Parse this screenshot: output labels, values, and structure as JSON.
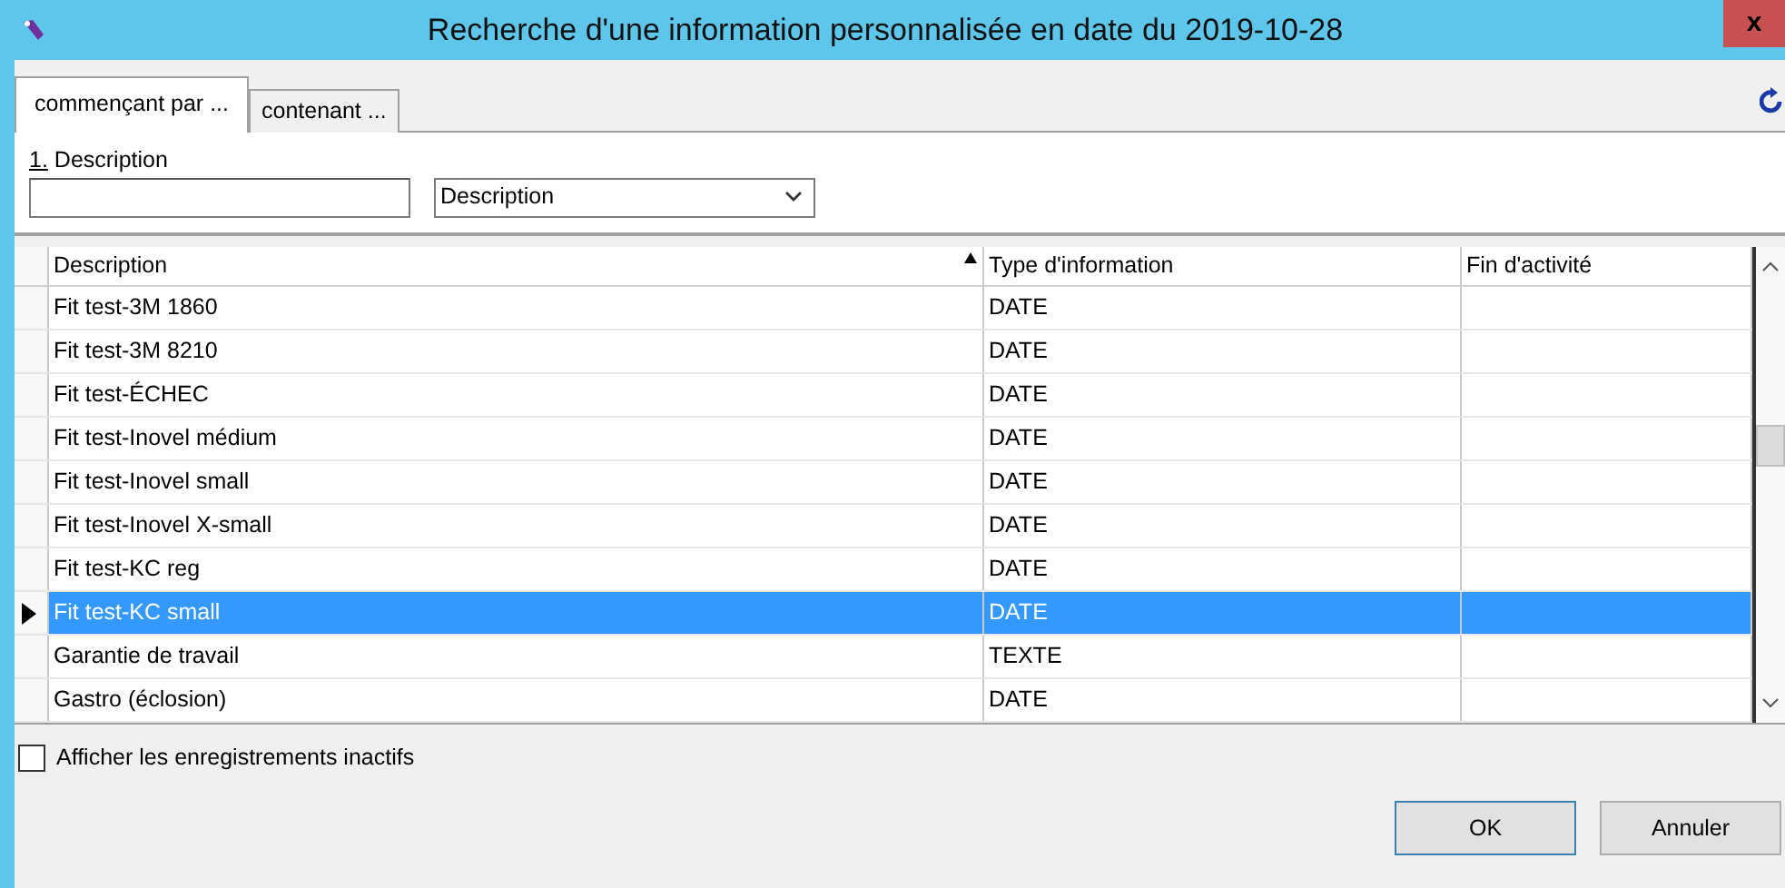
{
  "window": {
    "title": "Recherche d'une information personnalisée en date du 2019-10-28",
    "close": "x"
  },
  "tabs": [
    {
      "label": "commençant par ...",
      "selected": true
    },
    {
      "label": "contenant ...",
      "selected": false
    }
  ],
  "search": {
    "label": "1. Description",
    "field": "Description"
  },
  "table": {
    "columns": [
      {
        "label": "Description",
        "sorted": true
      },
      {
        "label": "Type d'information",
        "sorted": false
      },
      {
        "label": "Fin d'activité",
        "sorted": false
      }
    ],
    "rows": [
      {
        "cells": [
          "Fit test-3M 1860",
          "DATE",
          ""
        ],
        "selected": false
      },
      {
        "cells": [
          "Fit test-3M 8210",
          "DATE",
          ""
        ],
        "selected": false
      },
      {
        "cells": [
          "Fit test-ÉCHEC",
          "DATE",
          ""
        ],
        "selected": false
      },
      {
        "cells": [
          "Fit test-Inovel médium",
          "DATE",
          ""
        ],
        "selected": false
      },
      {
        "cells": [
          "Fit test-Inovel small",
          "DATE",
          ""
        ],
        "selected": false
      },
      {
        "cells": [
          "Fit test-Inovel X-small",
          "DATE",
          ""
        ],
        "selected": false
      },
      {
        "cells": [
          "Fit test-KC reg",
          "DATE",
          ""
        ],
        "selected": false
      },
      {
        "cells": [
          "Fit test-KC small",
          "DATE",
          ""
        ],
        "selected": true
      },
      {
        "cells": [
          "Garantie de travail",
          "TEXTE",
          ""
        ],
        "selected": false
      },
      {
        "cells": [
          "Gastro (éclosion)",
          "DATE",
          ""
        ],
        "selected": false
      }
    ]
  },
  "show_inactive": {
    "label": "Afficher les enregistrements inactifs",
    "checked": false
  },
  "buttons": [
    "OK",
    "Annuler"
  ]
}
